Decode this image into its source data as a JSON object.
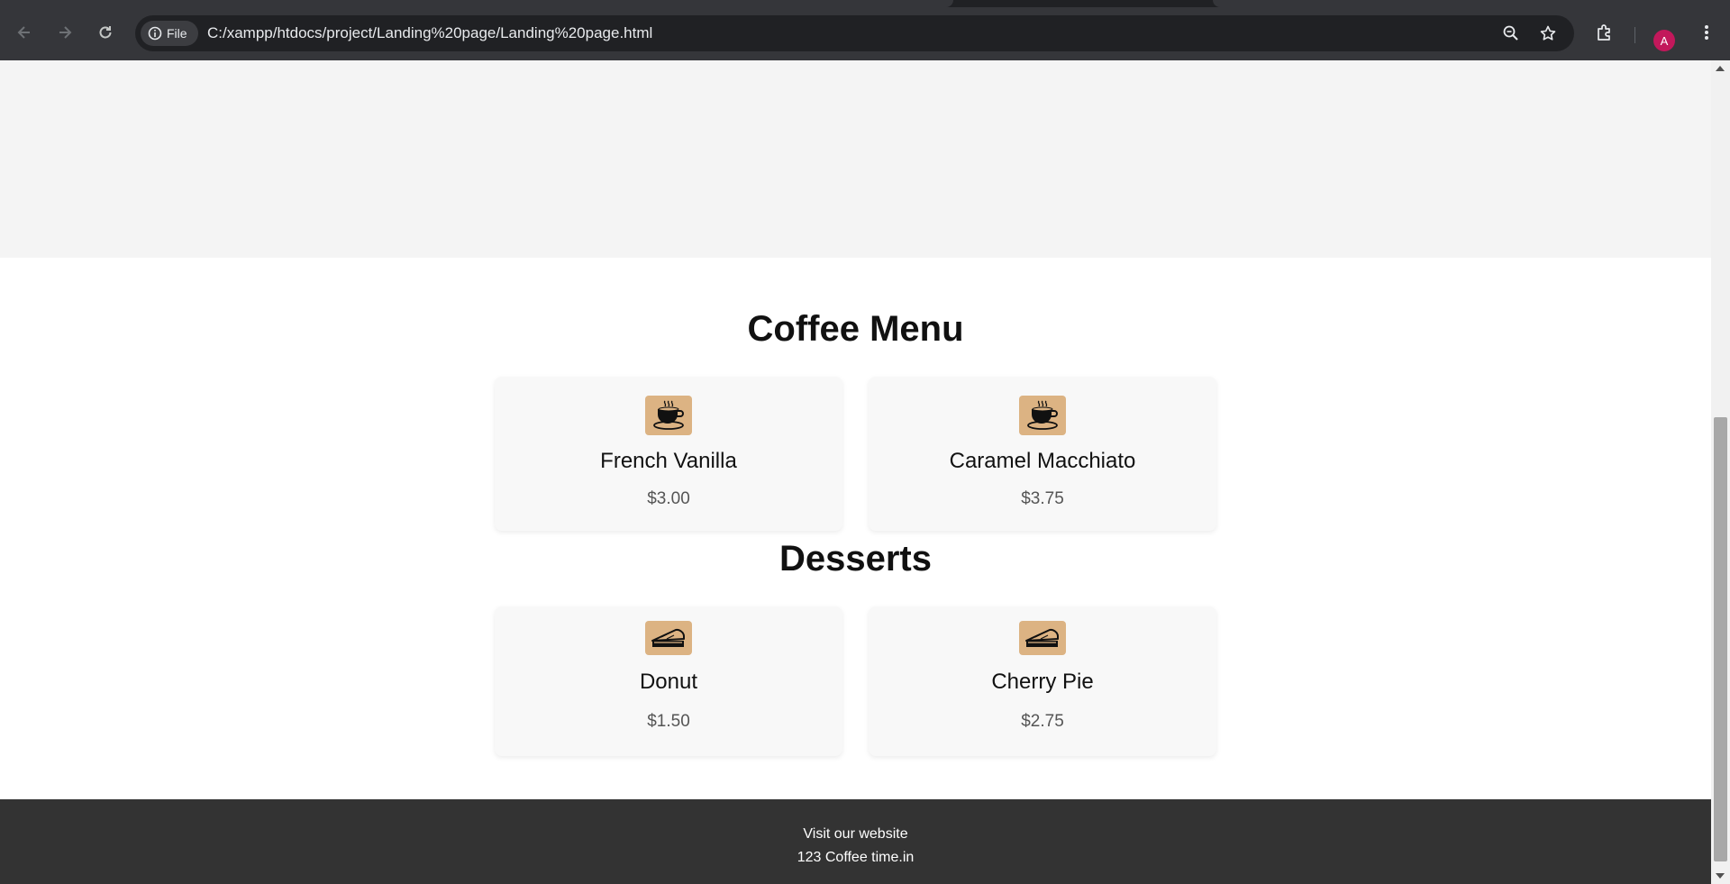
{
  "browser": {
    "site_chip_label": "File",
    "url": "C:/xampp/htdocs/project/Landing%20page/Landing%20page.html",
    "profile_initial": "A",
    "icons": [
      "back-arrow-icon",
      "forward-arrow-icon",
      "reload-icon",
      "info-icon",
      "zoom-icon",
      "star-icon",
      "extensions-icon",
      "more-icon"
    ]
  },
  "coffee": {
    "title": "Coffee Menu",
    "items": [
      {
        "name": "French Vanilla",
        "price": "$3.00",
        "icon": "coffee-cup-icon"
      },
      {
        "name": "Caramel Macchiato",
        "price": "$3.75",
        "icon": "coffee-cup-icon"
      }
    ]
  },
  "desserts": {
    "title": "Desserts",
    "items": [
      {
        "name": "Donut",
        "price": "$1.50",
        "icon": "pie-slice-icon"
      },
      {
        "name": "Cherry Pie",
        "price": "$2.75",
        "icon": "pie-slice-icon"
      }
    ]
  },
  "footer": {
    "line1": "Visit our website",
    "line2": "123 Coffee time.in"
  },
  "colors": {
    "chrome_toolbar": "#35363a",
    "omnibox": "#202124",
    "icon_bg": "#dcb383",
    "footer_bg": "#333333",
    "avatar": "#c2185b"
  }
}
